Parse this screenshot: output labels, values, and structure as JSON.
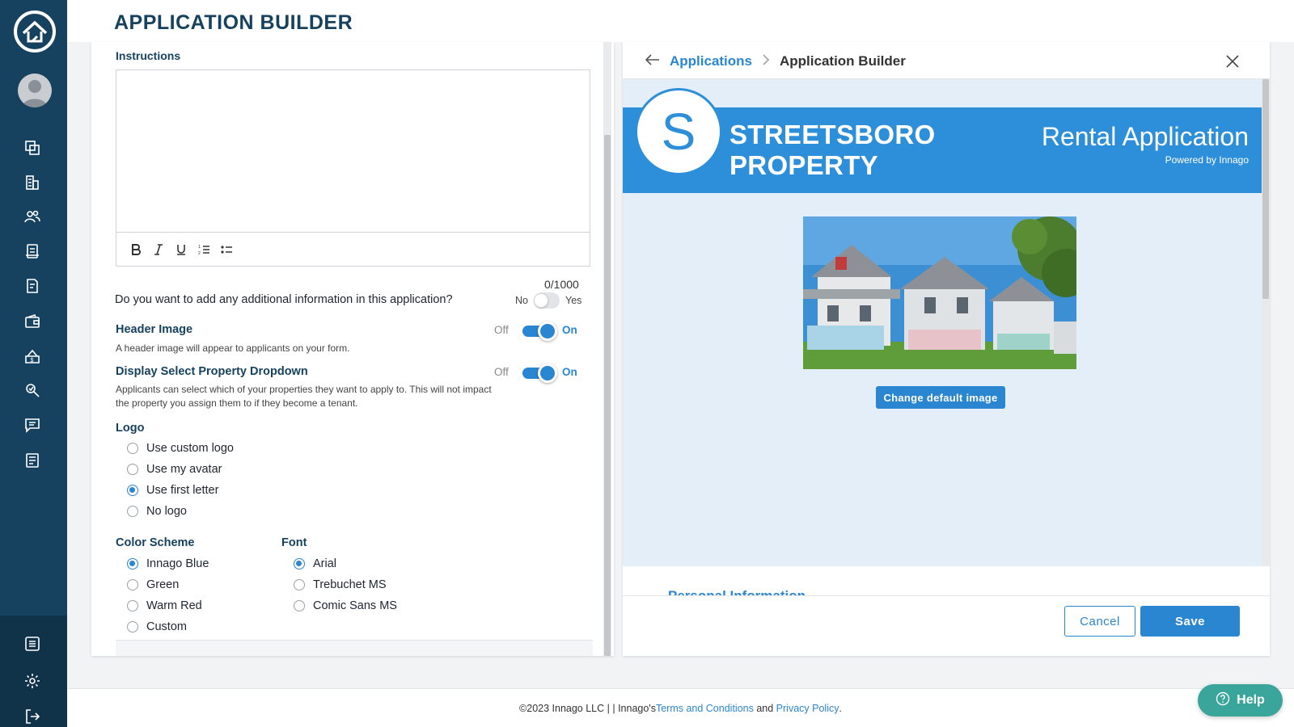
{
  "header": {
    "title": "APPLICATION BUILDER"
  },
  "sidebar": {
    "icons": [
      "home-logo-icon",
      "units-icon",
      "buildings-icon",
      "people-icon",
      "accounting-icon",
      "documents-icon",
      "wallet-icon",
      "payments-icon",
      "maintenance-icon",
      "messages-icon",
      "reports-icon"
    ],
    "bottom_icons": [
      "list-icon",
      "settings-icon",
      "logout-icon"
    ]
  },
  "form": {
    "instructions_label": "Instructions",
    "counter": "0/1000",
    "additional_info": {
      "question": "Do you want to add any additional information in this application?",
      "no": "No",
      "yes": "Yes"
    },
    "header_image": {
      "label": "Header Image",
      "hint": "A header image will appear to applicants on your form.",
      "off": "Off",
      "on": "On"
    },
    "property_dropdown": {
      "label": "Display Select Property Dropdown",
      "hint_1": "Applicants can select which of your properties they want to apply to. This will not impact",
      "hint_2": "the property you assign them to if they become a tenant.",
      "off": "Off",
      "on": "On"
    },
    "logo": {
      "label": "Logo",
      "options": [
        "Use custom logo",
        "Use my avatar",
        "Use first letter",
        "No logo"
      ],
      "selected": "Use first letter"
    },
    "color_scheme": {
      "label": "Color Scheme",
      "options": [
        "Innago Blue",
        "Green",
        "Warm Red",
        "Custom"
      ],
      "selected": "Innago Blue"
    },
    "font": {
      "label": "Font",
      "options": [
        "Arial",
        "Trebuchet MS",
        "Comic Sans MS"
      ],
      "selected": "Arial"
    }
  },
  "preview": {
    "breadcrumb": {
      "link": "Applications",
      "current": "Application Builder"
    },
    "letter": "S",
    "company_line_1": "STREETSBORO",
    "company_line_2": "PROPERTY",
    "title": "Rental Application",
    "powered_by": "Powered by Innago",
    "change_image_label": "Change default image",
    "next_section": "Personal Information",
    "cancel_label": "Cancel",
    "save_label": "Save",
    "accent_color": "#2d8fd9"
  },
  "footer": {
    "copyright": "©2023 Innago LLC | | Innago's ",
    "terms": "Terms and Conditions",
    "and": " and ",
    "privacy": "Privacy Policy",
    "period": "."
  },
  "help_label": "Help"
}
